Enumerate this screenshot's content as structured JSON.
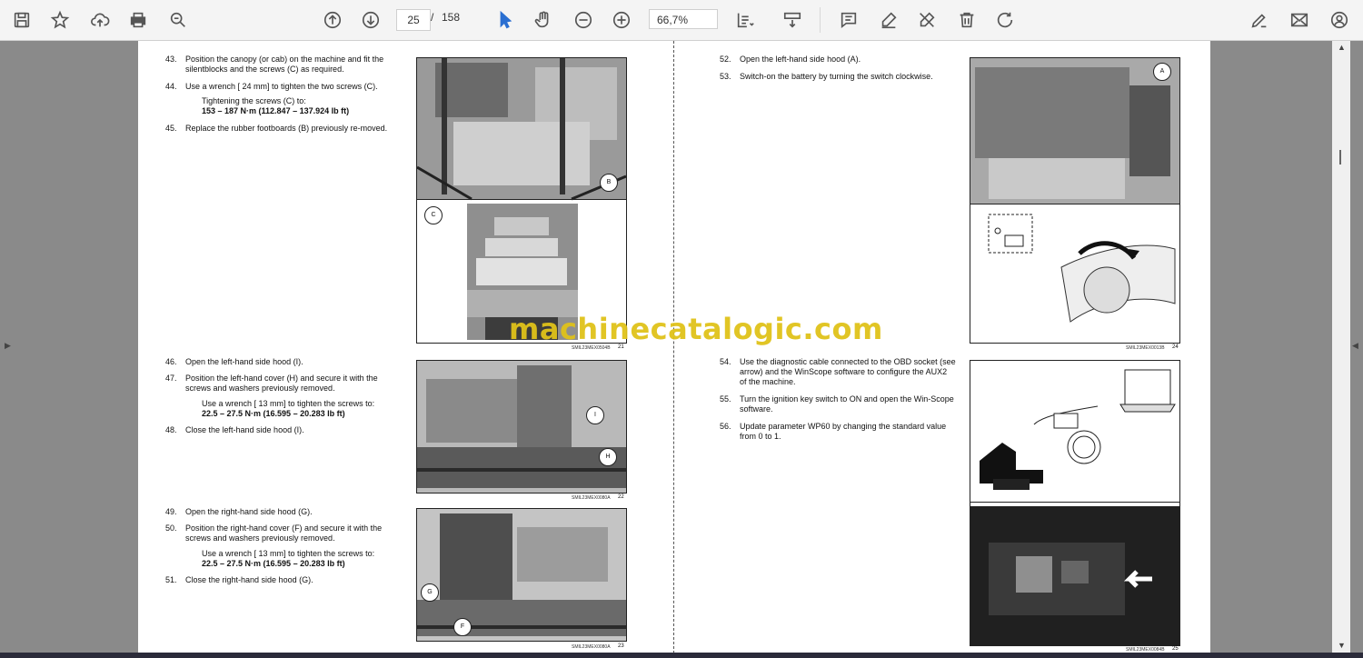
{
  "toolbar": {
    "page_current": "25",
    "page_sep": "/",
    "page_total": "158",
    "zoom": "66,7%",
    "icons": [
      "save-icon",
      "star-icon",
      "upload-icon",
      "print-icon",
      "zoom-search-icon",
      "page-up-icon",
      "page-down-icon",
      "pointer-icon",
      "hand-icon",
      "zoom-out-icon",
      "zoom-in-icon",
      "fit-page-icon",
      "scroll-mode-icon",
      "comment-icon",
      "highlight-icon",
      "sign-icon",
      "delete-icon",
      "rotate-icon",
      "fill-sign-icon",
      "mail-icon",
      "account-icon"
    ]
  },
  "watermark": "machinecatalogic.com",
  "left_page": {
    "steps": [
      {
        "n": "43.",
        "text": "Position the canopy (or cab) on the machine and fit the silentblocks and the screws (C) as required."
      },
      {
        "n": "44.",
        "text": "Use a wrench [ 24 mm] to tighten the two screws (C)."
      },
      {
        "n": "45.",
        "text": "Replace the rubber footboards (B) previously re-moved."
      },
      {
        "n": "46.",
        "text": "Open the left-hand side hood (I)."
      },
      {
        "n": "47.",
        "text": "Position the left-hand cover (H) and secure it with the screws and washers previously removed."
      },
      {
        "n": "48.",
        "text": "Close the left-hand side hood (I)."
      },
      {
        "n": "49.",
        "text": "Open the right-hand side hood (G)."
      },
      {
        "n": "50.",
        "text": "Position the right-hand cover (F) and secure it with the screws and washers previously removed."
      },
      {
        "n": "51.",
        "text": "Close the right-hand side hood (G)."
      }
    ],
    "sub44a": "Tightening the screws (C) to:",
    "sub44b": "153 – 187 N·m (112.847 – 137.924 lb ft)",
    "sub47a": "Use a wrench [ 13 mm] to tighten the screws to:",
    "sub47b": "22.5 – 27.5 N·m (16.595 – 20.283 lb ft)",
    "sub50a": "Use a wrench [ 13 mm] to tighten the screws to:",
    "sub50b": "22.5 – 27.5 N·m (16.595 – 20.283 lb ft)",
    "figs": [
      {
        "code": "SMIL23MEX0504B",
        "num": "21"
      },
      {
        "code": "SMIL23MEX0080A",
        "num": "22"
      },
      {
        "code": "SMIL23MEX0080A",
        "num": "23"
      }
    ]
  },
  "right_page": {
    "steps": [
      {
        "n": "52.",
        "text": "Open the left-hand side hood (A)."
      },
      {
        "n": "53.",
        "text": "Switch-on the battery by turning the switch clockwise."
      },
      {
        "n": "54.",
        "text": "Use the diagnostic cable connected to the OBD socket (see arrow) and the WinScope software to configure the AUX2 of the machine."
      },
      {
        "n": "55.",
        "text": "Turn the ignition key switch to ON and open the Win-Scope software."
      },
      {
        "n": "56.",
        "text": "Update parameter WP60 by changing the standard value from 0 to 1."
      }
    ],
    "figs": [
      {
        "code": "SMIL23MEX0013B",
        "num": "24"
      },
      {
        "code": "SMIL23MEX0084B",
        "num": "25"
      }
    ]
  },
  "callouts": {
    "b": "B",
    "c": "C",
    "i": "I",
    "h": "H",
    "g": "G",
    "f": "F",
    "a": "A"
  }
}
